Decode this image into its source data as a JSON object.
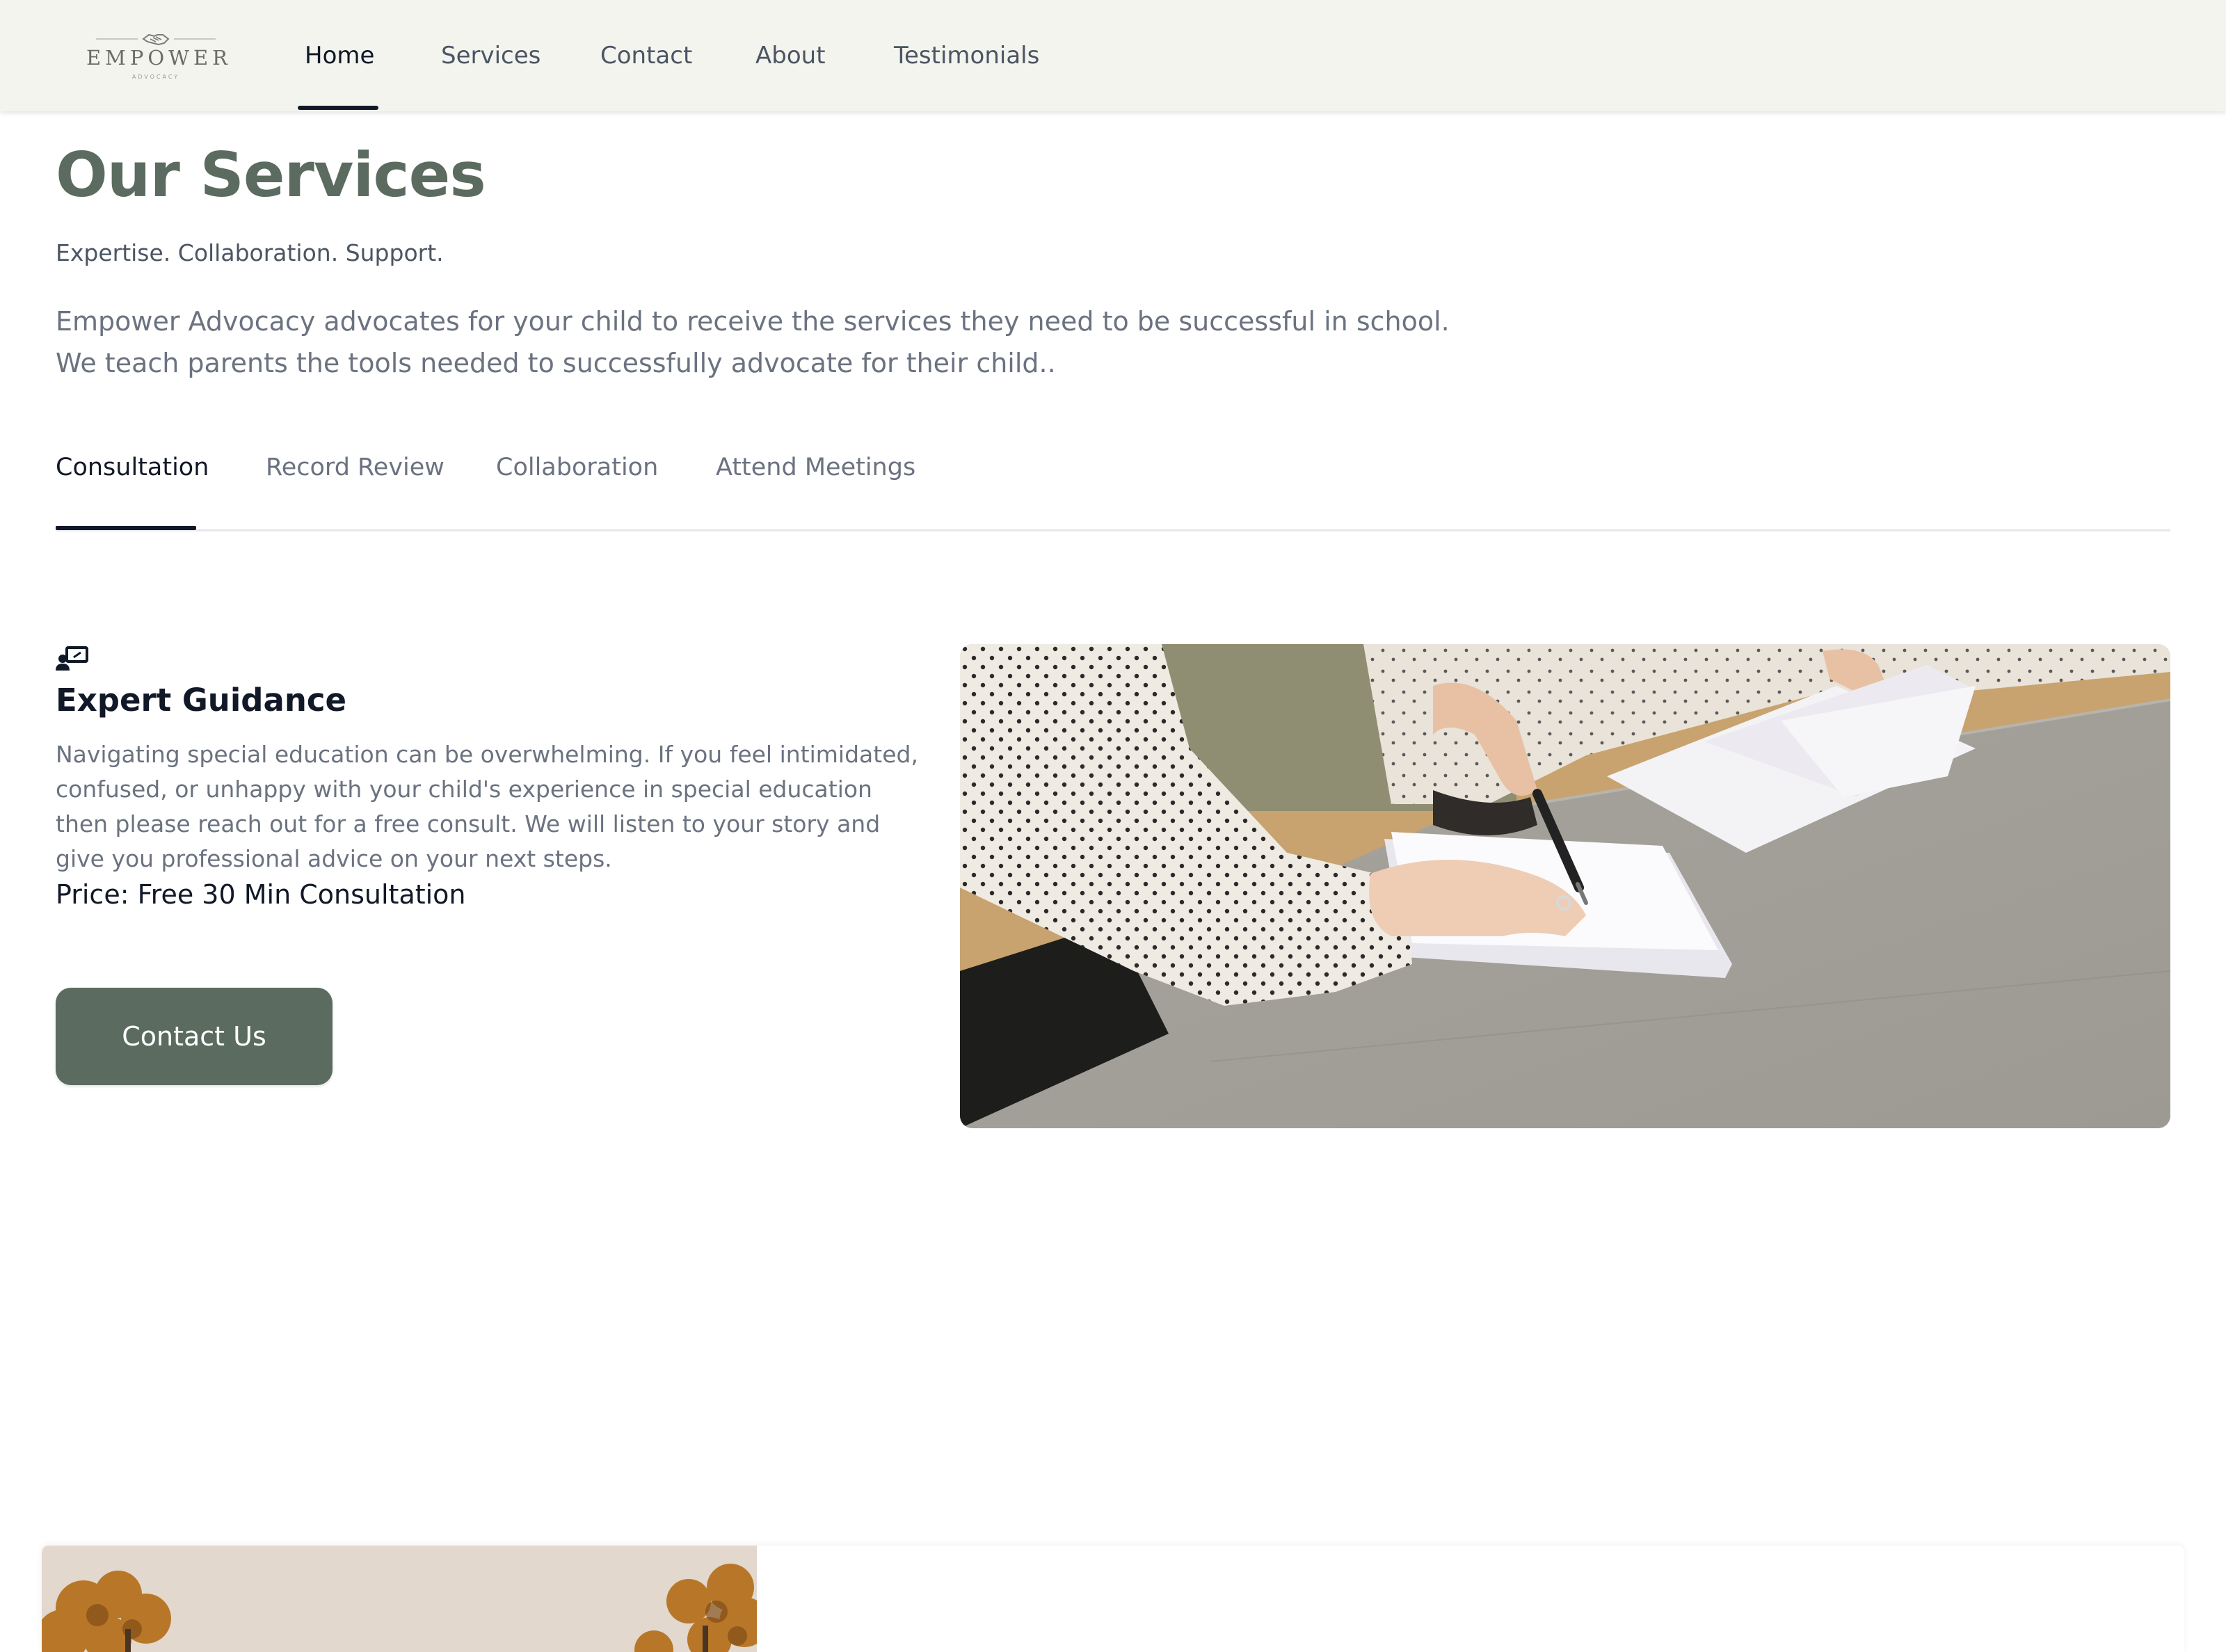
{
  "brand": {
    "name": "EMPOWER",
    "sub": "ADVOCACY"
  },
  "nav": {
    "items": [
      "Home",
      "Services",
      "Contact",
      "About",
      "Testimonials"
    ],
    "active": "Home"
  },
  "page": {
    "title": "Our Services",
    "tagline": "Expertise. Collaboration. Support.",
    "intro_lines": [
      "Empower Advocacy advocates for your child to receive the services they need to be successful in school.",
      "We teach parents the tools needed to successfully advocate for their child.."
    ]
  },
  "tabs": {
    "items": [
      "Consultation",
      "Record Review",
      "Collaboration",
      "Attend Meetings"
    ],
    "active": "Consultation"
  },
  "service": {
    "icon": "presentation-person-icon",
    "title": "Expert Guidance",
    "description": "Navigating special education can be overwhelming. If you feel intimidated, confused, or unhappy with your child's experience in special education then please reach out for a free consult. We will listen to your story and give you professional advice on your next steps.",
    "price": "Price: Free 30 Min Consultation",
    "cta_label": "Contact Us",
    "photo": "people-signing-documents-photo"
  },
  "bottom_card": {
    "photo": "autumn-trees-photo"
  },
  "colors": {
    "brand_green": "#5b6b60",
    "nav_bg": "#f4f4ef",
    "active_text": "#111827",
    "muted_text": "#6b7280"
  }
}
